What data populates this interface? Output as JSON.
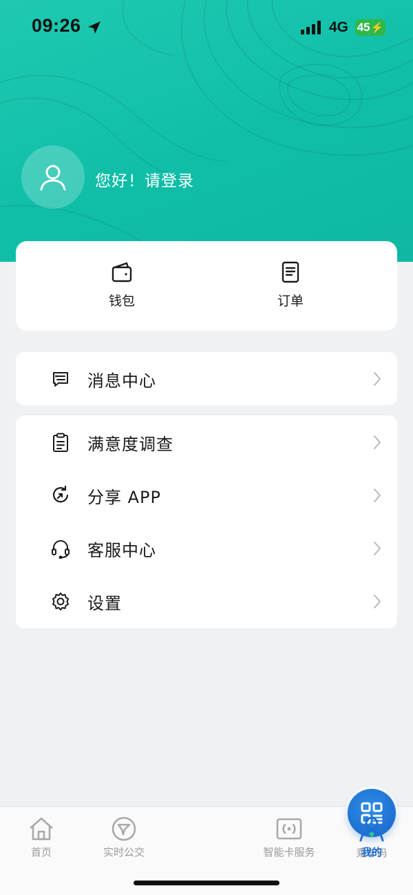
{
  "status_bar": {
    "time": "09:26",
    "network": "4G",
    "battery": "45",
    "location_icon": "location-arrow-icon",
    "signal_icon": "cellular-signal-icon"
  },
  "header": {
    "greeting": "您好！请登录",
    "avatar_icon": "user-avatar-icon",
    "background_color": "#12c0a9"
  },
  "quick_actions": [
    {
      "label": "钱包",
      "icon": "wallet-icon"
    },
    {
      "label": "订单",
      "icon": "order-document-icon"
    }
  ],
  "menu_groups": [
    [
      {
        "label": "消息中心",
        "icon": "message-icon"
      }
    ],
    [
      {
        "label": "满意度调查",
        "icon": "clipboard-icon"
      },
      {
        "label": "分享 APP",
        "icon": "share-refresh-icon"
      },
      {
        "label": "客服中心",
        "icon": "headset-icon"
      },
      {
        "label": "设置",
        "icon": "gear-icon"
      }
    ]
  ],
  "tabbar": {
    "items": [
      {
        "label": "首页",
        "icon": "home-icon"
      },
      {
        "label": "实时公交",
        "icon": "realtime-bus-icon"
      },
      {
        "label": "乘车码",
        "icon": "qr-code-icon"
      },
      {
        "label": "智能卡服务",
        "icon": "smart-card-icon"
      },
      {
        "label": "我的",
        "icon": "profile-icon",
        "active": true
      }
    ],
    "active_color": "#1f6fd1",
    "inactive_color": "#9a9a9a"
  }
}
